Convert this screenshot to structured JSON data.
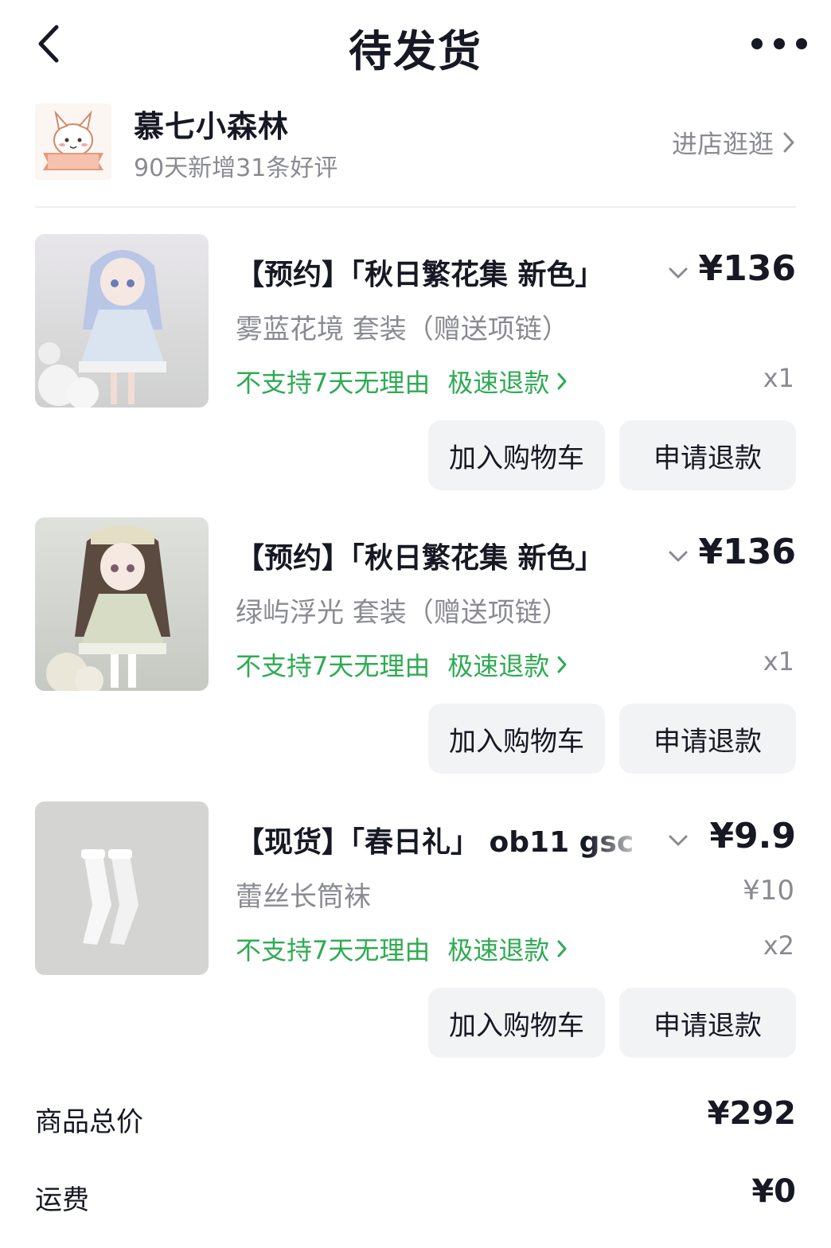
{
  "header": {
    "title": "待发货"
  },
  "shop": {
    "name": "慕七小森林",
    "subtitle": "90天新增31条好评",
    "enter_label": "进店逛逛",
    "logo_text": "慕七小森林"
  },
  "items": [
    {
      "title": "【预约】「秋日繁花集 新色」",
      "price": "¥136",
      "variant": "雾蓝花境 套装（赠送项链）",
      "original_price": "",
      "policy": "不支持7天无理由",
      "refund_label": "极速退款",
      "qty": "x1",
      "cart_label": "加入购物车",
      "refund_button": "申请退款"
    },
    {
      "title": "【预约】「秋日繁花集 新色」",
      "price": "¥136",
      "variant": "绿屿浮光 套装（赠送项链）",
      "original_price": "",
      "policy": "不支持7天无理由",
      "refund_label": "极速退款",
      "qty": "x1",
      "cart_label": "加入购物车",
      "refund_button": "申请退款"
    },
    {
      "title": "【现货】「春日礼」 ob11 gsc",
      "price": "¥9.9",
      "variant": "蕾丝长筒袜",
      "original_price": "¥10",
      "policy": "不支持7天无理由",
      "refund_label": "极速退款",
      "qty": "x2",
      "cart_label": "加入购物车",
      "refund_button": "申请退款"
    }
  ],
  "summary": {
    "goods_total_label": "商品总价",
    "goods_total_value": "¥292",
    "shipping_label": "运费",
    "shipping_value": "¥0"
  },
  "colors": {
    "text": "#161823",
    "muted": "#8a8b91",
    "green": "#2fab53",
    "button_bg": "#f2f3f5"
  }
}
